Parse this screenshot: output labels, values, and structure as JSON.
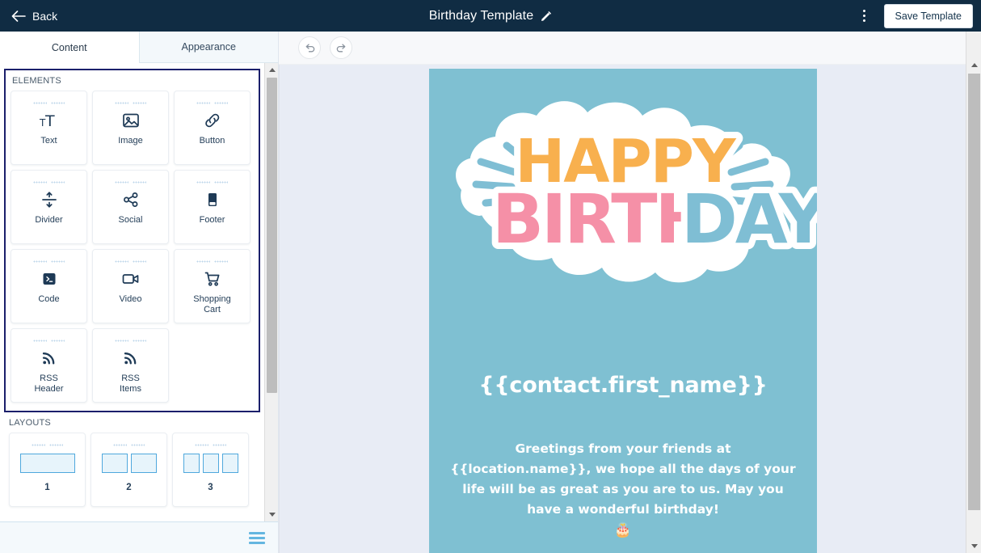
{
  "topbar": {
    "back_label": "Back",
    "title": "Birthday Template",
    "edit_icon": "pencil-icon",
    "menu_icon": "kebab-menu-icon",
    "save_label": "Save Template",
    "bg_color": "#102c43"
  },
  "sidebar": {
    "tabs": [
      {
        "label": "Content",
        "active": true
      },
      {
        "label": "Appearance",
        "active": false
      }
    ],
    "elements_section_label": "ELEMENTS",
    "elements": [
      {
        "label": "Text",
        "icon": "text-icon"
      },
      {
        "label": "Image",
        "icon": "image-icon"
      },
      {
        "label": "Button",
        "icon": "link-icon"
      },
      {
        "label": "Divider",
        "icon": "divider-icon"
      },
      {
        "label": "Social",
        "icon": "share-icon"
      },
      {
        "label": "Footer",
        "icon": "footer-icon"
      },
      {
        "label": "Code",
        "icon": "code-icon"
      },
      {
        "label": "Video",
        "icon": "video-icon"
      },
      {
        "label": "Shopping\nCart",
        "icon": "shopping-cart-icon"
      },
      {
        "label": "RSS\nHeader",
        "icon": "rss-icon"
      },
      {
        "label": "RSS\nItems",
        "icon": "rss-icon"
      }
    ],
    "layouts_section_label": "LAYOUTS",
    "layouts": [
      {
        "label": "1",
        "columns": 1
      },
      {
        "label": "2",
        "columns": 2
      },
      {
        "label": "3",
        "columns": 3
      }
    ],
    "bottom_menu_icon": "hamburger-icon",
    "selection_border_color": "#1b1f6b"
  },
  "canvas": {
    "undo_icon": "undo-icon",
    "redo_icon": "redo-icon",
    "background_color": "#e8ecf5"
  },
  "email": {
    "background_color": "#7fc0d2",
    "banner": {
      "word_1": "HAPPY",
      "word_1_color": "#f8b04e",
      "word_2": "BIRTH",
      "word_2_color": "#f590a7",
      "word_3": "DAY",
      "word_3_color": "#7fbed4",
      "outline_color": "#ffffff"
    },
    "heading": "{{contact.first_name}}",
    "body": "Greetings from your friends at {{location.name}}, we hope all the days of your life will be as great as you are to us. May you have a wonderful birthday!",
    "emoji": "🎂",
    "text_color": "#ffffff"
  },
  "scrollbars": {
    "up_arrow_icon": "scroll-up-arrow-icon",
    "down_arrow_icon": "scroll-down-arrow-icon"
  }
}
